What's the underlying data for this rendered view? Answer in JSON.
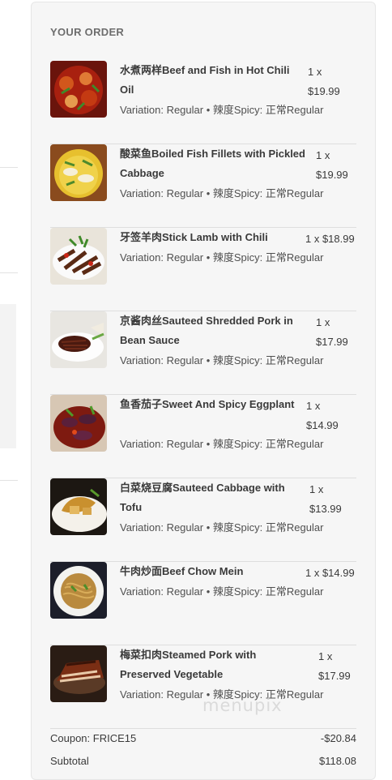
{
  "order": {
    "title": "YOUR ORDER",
    "items": [
      {
        "name": "水煮两样Beef and Fish in Hot Chili Oil",
        "qty_line1": "1 x",
        "qty_line2": "$19.99",
        "variation": "Variation: Regular • 辣度Spicy: 正常Regular",
        "image_icon": "beef-fish-chili-oil-photo"
      },
      {
        "name": "酸菜鱼Boiled Fish Fillets with Pickled Cabbage",
        "qty_line1": "1 x",
        "qty_line2": "$19.99",
        "variation": "Variation: Regular • 辣度Spicy: 正常Regular",
        "image_icon": "pickled-cabbage-fish-photo"
      },
      {
        "name": "牙签羊肉Stick Lamb with Chili",
        "qty_line1": "1 x $18.99",
        "qty_line2": "",
        "variation": "Variation: Regular • 辣度Spicy: 正常Regular",
        "image_icon": "stick-lamb-photo"
      },
      {
        "name": "京酱肉丝Sauteed Shredded Pork in Bean Sauce",
        "qty_line1": "1 x",
        "qty_line2": "$17.99",
        "variation": "Variation: Regular • 辣度Spicy: 正常Regular",
        "image_icon": "shredded-pork-photo"
      },
      {
        "name": "鱼香茄子Sweet And Spicy Eggplant",
        "qty_line1": "1 x",
        "qty_line2": "$14.99",
        "variation": "Variation: Regular • 辣度Spicy: 正常Regular",
        "image_icon": "eggplant-photo"
      },
      {
        "name": "白菜烧豆腐Sauteed Cabbage with Tofu",
        "qty_line1": "1 x",
        "qty_line2": "$13.99",
        "variation": "Variation: Regular • 辣度Spicy: 正常Regular",
        "image_icon": "cabbage-tofu-photo"
      },
      {
        "name": "牛肉炒面Beef Chow Mein",
        "qty_line1": "1 x $14.99",
        "qty_line2": "",
        "variation": "Variation: Regular • 辣度Spicy: 正常Regular",
        "image_icon": "chow-mein-photo"
      },
      {
        "name": "梅菜扣肉Steamed Pork with Preserved Vegetable",
        "qty_line1": "1 x",
        "qty_line2": "$17.99",
        "variation": "Variation: Regular • 辣度Spicy: 正常Regular",
        "image_icon": "steamed-pork-photo"
      }
    ],
    "coupon": {
      "label": "Coupon: FRICE15",
      "value": "-$20.84"
    },
    "subtotal": {
      "label": "Subtotal",
      "value": "$118.08"
    }
  },
  "watermark": "menupix",
  "colors": {
    "panel_bg": "#f6f6f6",
    "text": "#3a3a3a",
    "muted": "#505050",
    "divider": "#dedede"
  }
}
